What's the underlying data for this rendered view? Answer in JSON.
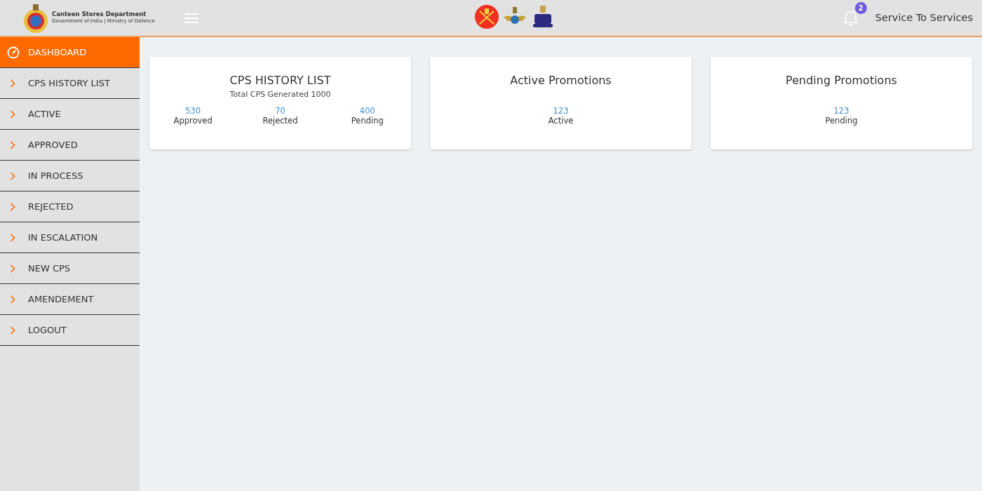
{
  "header": {
    "brand_title": "Canteen Stores Department",
    "brand_subtitle": "Government of India | Ministry of Defence",
    "notification_count": "2",
    "user": "Service To Services"
  },
  "sidebar": {
    "items": [
      {
        "label": "DASHBOARD",
        "kind": "dashboard",
        "selected": true
      },
      {
        "label": "CPS HISTORY LIST",
        "kind": "link",
        "selected": false
      },
      {
        "label": "ACTIVE",
        "kind": "link",
        "selected": false
      },
      {
        "label": "APPROVED",
        "kind": "link",
        "selected": false
      },
      {
        "label": "IN PROCESS",
        "kind": "link",
        "selected": false
      },
      {
        "label": "REJECTED",
        "kind": "link",
        "selected": false
      },
      {
        "label": "IN ESCALATION",
        "kind": "link",
        "selected": false
      },
      {
        "label": "NEW CPS",
        "kind": "link",
        "selected": false
      },
      {
        "label": "AMENDEMENT",
        "kind": "link",
        "selected": false
      },
      {
        "label": "LOGOUT",
        "kind": "link",
        "selected": false
      }
    ]
  },
  "cards": [
    {
      "title": "CPS HISTORY LIST",
      "subtitle": "Total CPS Generated 1000",
      "stats": [
        {
          "value": "530",
          "label": "Approved"
        },
        {
          "value": "70",
          "label": "Rejected"
        },
        {
          "value": "400",
          "label": "Pending"
        }
      ]
    },
    {
      "title": "Active Promotions",
      "stats": [
        {
          "value": "123",
          "label": "Active"
        }
      ]
    },
    {
      "title": "Pending Promotions",
      "stats": [
        {
          "value": "123",
          "label": "Pending"
        }
      ]
    }
  ]
}
